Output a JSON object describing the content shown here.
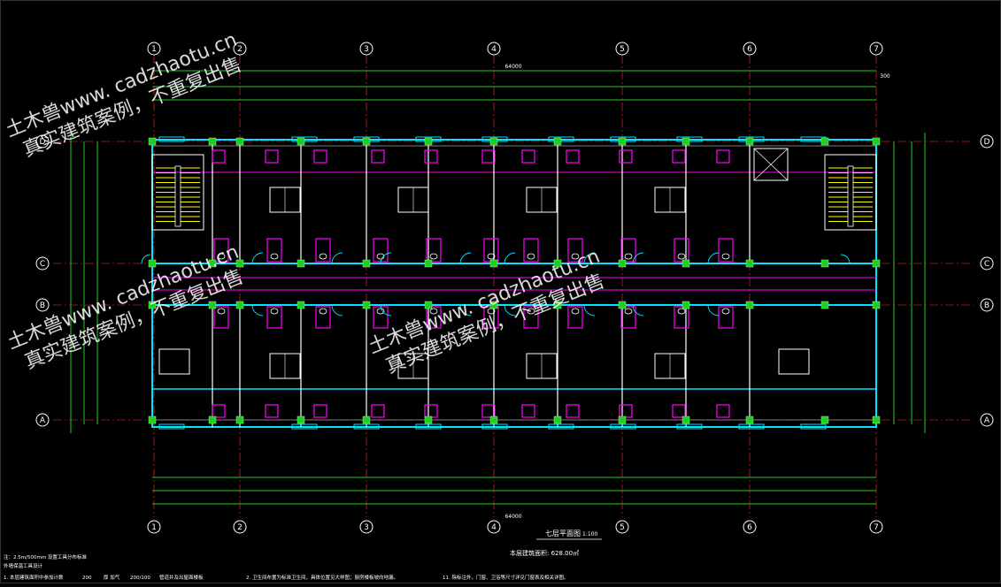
{
  "drawing": {
    "title": "七层平面图",
    "scale": "1:100",
    "area_note": "本层建筑面积: 628.00㎡",
    "axes_numbers": [
      "1",
      "2",
      "3",
      "4",
      "5",
      "6",
      "7"
    ],
    "axes_letters": [
      "A",
      "B",
      "C",
      "D"
    ],
    "overall_dimension_top": "64000",
    "overall_dimension_bottom": "64000",
    "right_total_dim": "300"
  },
  "watermark": {
    "site": "土木兽www. cadzhaotu.cn",
    "slogan": "真实建筑案例，不重复出售"
  },
  "notes": {
    "line1": "注：2.5m/500mm 设置工具分布标准",
    "line2": "外墙保温工具设计",
    "line3_a": "1. 本层建筑面积中参加计数",
    "line3_b": "200",
    "line3_c": "厚 加气",
    "line3_d": "200/100",
    "line3_e": "管道井及出屋面楼板",
    "line4": "2. 卫生间布置为标准卫生间，具体位置见大样图；厨房楼板坡向地漏。",
    "line5": "11. 除标注外，门窗、卫浴等尺寸详见门窗表及相关详图。"
  },
  "colors": {
    "background": "#000000",
    "cyan": "#00e5ff",
    "magenta": "#ff00ff",
    "yellow": "#ffff00",
    "green": "#22cc22",
    "white": "#ffffff",
    "red": "#ff3333",
    "gray": "#a0a0a0"
  }
}
